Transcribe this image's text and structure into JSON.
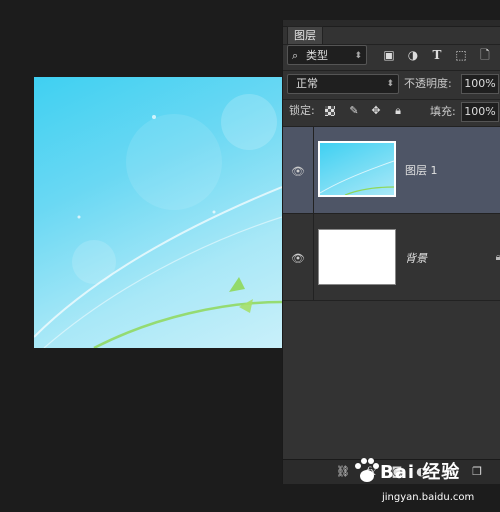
{
  "canvas": {
    "colors": {
      "sky_top": "#3fd0f2",
      "sky_bottom": "#c9f0fa",
      "leaf": "#8fd85a"
    }
  },
  "layers_panel": {
    "tab_label": "图层",
    "filter": {
      "label": "类型",
      "icons": [
        "image-filter-icon",
        "adjustment-filter-icon",
        "type-filter-icon",
        "shape-filter-icon",
        "smart-object-filter-icon"
      ]
    },
    "blend_mode": "正常",
    "opacity_label": "不透明度:",
    "opacity_value": "100%",
    "lock_label": "锁定:",
    "fill_label": "填充:",
    "fill_value": "100%",
    "layers": [
      {
        "name": "图层 1",
        "visible": true,
        "selected": true
      },
      {
        "name": "背景",
        "visible": true,
        "selected": false
      }
    ],
    "bottom_icons": [
      "link-layers-icon",
      "fx-icon",
      "add-mask-icon",
      "adjustment-layer-icon",
      "new-group-icon",
      "new-layer-icon"
    ]
  },
  "watermark": {
    "logo": "Bai 经验",
    "url": "jingyan.baidu.com"
  }
}
